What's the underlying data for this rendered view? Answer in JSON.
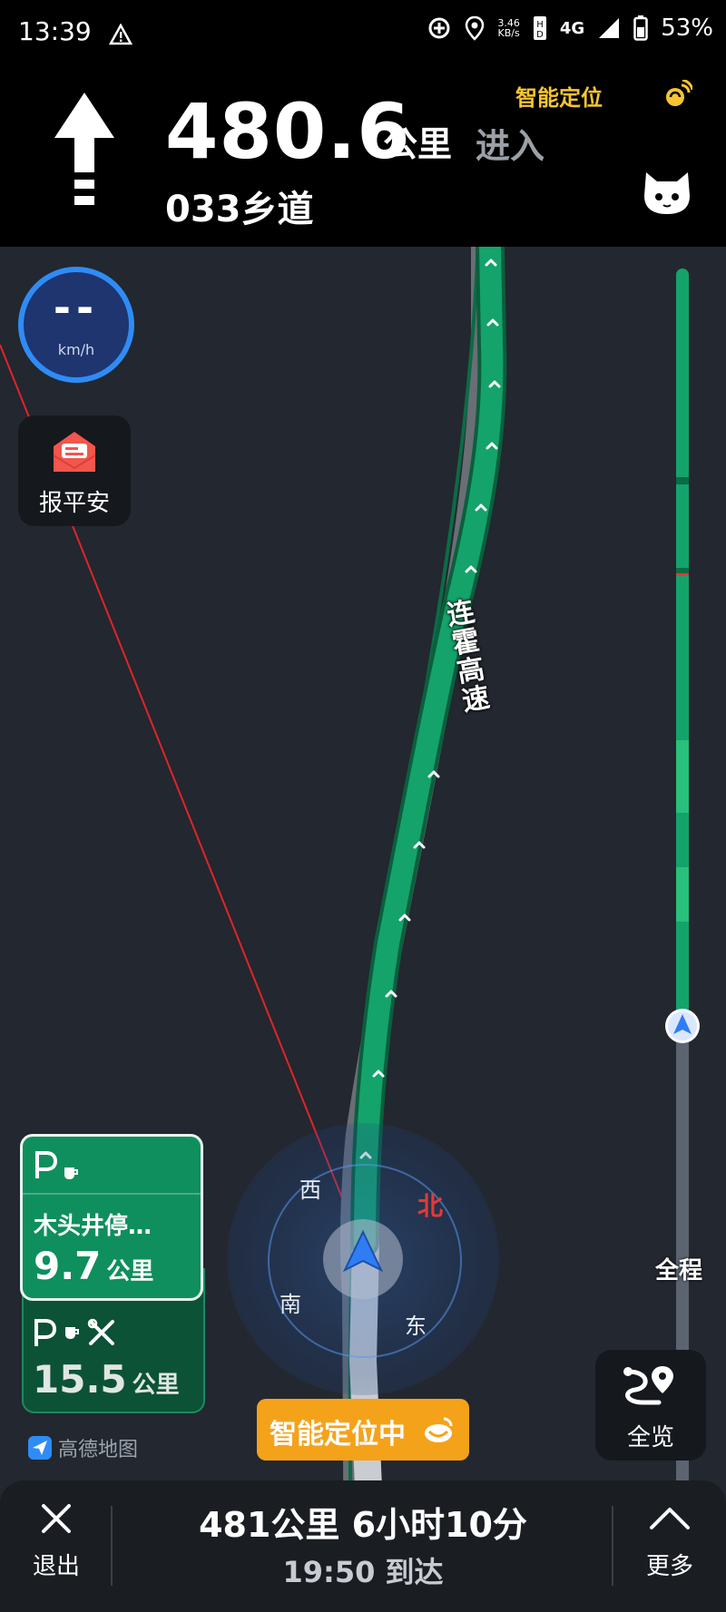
{
  "status_bar": {
    "time": "13:39",
    "net_speed_value": "3.46",
    "net_speed_unit": "KB/s",
    "network": "4G",
    "battery": "53%",
    "icons": [
      "warning-icon",
      "data-saver-icon",
      "location-icon",
      "hd-icon",
      "signal-icon",
      "battery-icon"
    ]
  },
  "nav": {
    "maneuver_icon": "straight-arrow-icon",
    "distance": "480.6",
    "distance_unit": "公里",
    "action": "进入",
    "road": "033乡道",
    "smart_location_label": "智能定位",
    "assistant_icon": "cat-avatar-icon"
  },
  "speed": {
    "value": "--",
    "unit": "km/h"
  },
  "report_safe": {
    "label": "报平安",
    "icon": "envelope-icon"
  },
  "map": {
    "road_label": "连霍高速",
    "compass": {
      "north": "北",
      "south": "南",
      "east": "东",
      "west": "西"
    },
    "brand": "高德地图",
    "colors": {
      "route": "#12a46c",
      "map_bg": "#23272f",
      "north_red": "#e53935",
      "locate_orange": "#f5a21b"
    }
  },
  "progress": {
    "label": "全程",
    "completed_fraction": 0.29
  },
  "service_areas": [
    {
      "icons": [
        "parking-icon",
        "coffee-icon"
      ],
      "name": "木头井停…",
      "distance": "9.7",
      "unit": "公里"
    },
    {
      "icons": [
        "parking-icon",
        "coffee-icon",
        "repair-tools-icon"
      ],
      "distance": "15.5",
      "unit": "公里"
    }
  ],
  "smart_locating_button": "智能定位中",
  "overview_button": "全览",
  "bottom_bar": {
    "exit_label": "退出",
    "summary": "481公里 6小时10分",
    "arrival": "19:50 到达",
    "more_label": "更多"
  }
}
